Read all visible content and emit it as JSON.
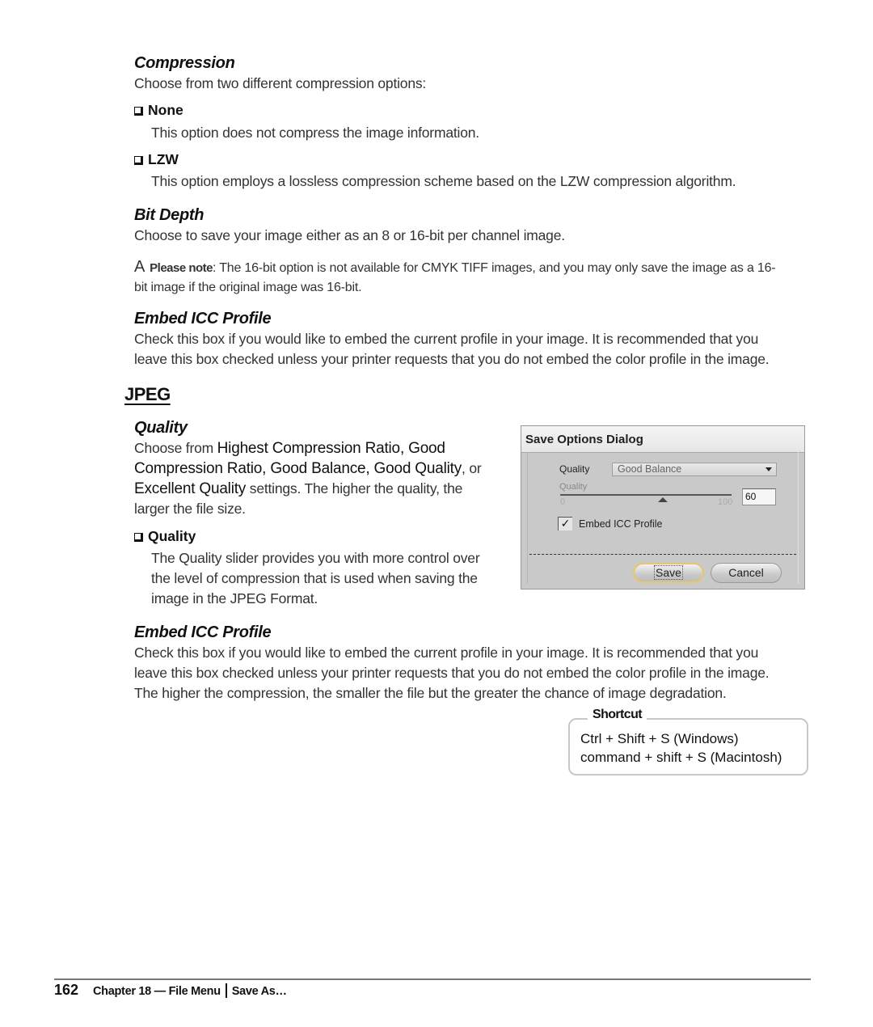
{
  "compression": {
    "heading": "Compression",
    "intro": "Choose from two different compression options:",
    "options": [
      {
        "label": "None",
        "description": "This option does not compress the image information."
      },
      {
        "label": "LZW",
        "description": "This option employs a lossless compression scheme based on the LZW compression algorithm."
      }
    ]
  },
  "bit_depth": {
    "heading": "Bit Depth",
    "text": "Choose to save your image either as an 8 or 16-bit per channel image.",
    "note_icon": "A",
    "note_label": "Please note",
    "note_text_1": ": The 16-bit option is not available for CMYK TIFF images, and you may only save the image as a 16-",
    "note_text_2": "bit image if the original image was 16-bit."
  },
  "embed_icc_tiff": {
    "heading": "Embed ICC Profile",
    "line1": "Check this box if you would like to embed the current profile in your image. It is recommended that you",
    "line2": "leave this box checked unless your printer requests that you do not embed the color profile in the image."
  },
  "jpeg": {
    "title": "JPEG",
    "quality": {
      "heading": "Quality",
      "choose_from": "Choose from ",
      "opt1": "Highest Compression Ratio",
      "sep1": ", ",
      "opt2a": "Good",
      "opt2b": "Compression Ratio",
      "sep2": ", ",
      "opt3": "Good Balance",
      "sep3": ", ",
      "opt4": "Good Quality",
      "or": ", or",
      "opt5": "Excellent Quality",
      "settings_text": " settings. The higher the quality, the",
      "last_line": "larger the file size.",
      "sub_option": {
        "label": "Quality",
        "line1": "The Quality slider provides you with more control over",
        "line2": "the level of compression that is used when saving the",
        "line3": "image in the JPEG Format."
      }
    },
    "embed_icc": {
      "heading": "Embed ICC Profile",
      "line1": "Check this box if you would like to embed the current profile in your image. It is recommended that you",
      "line2": "leave this box checked unless your printer requests that you do not embed the color profile in the image.",
      "line3": "The higher the compression, the smaller the file but the greater the chance of image degradation."
    }
  },
  "dialog": {
    "title": "Save Options Dialog",
    "quality_label": "Quality",
    "quality_select_value": "Good Balance",
    "slider_label": "Quality",
    "slider_min": "0",
    "slider_max": "100",
    "slider_value_fraction": 0.6,
    "quality_input_value": "60",
    "embed_checkbox_checked": true,
    "embed_checkbox_mark": "✓",
    "embed_checkbox_label": "Embed ICC Profile",
    "save_label": "Save",
    "cancel_label": "Cancel"
  },
  "shortcut": {
    "label": "Shortcut",
    "windows": "Ctrl + Shift + S (Windows)",
    "mac": "command + shift + S (Macintosh)"
  },
  "footer": {
    "page_number": "162",
    "chapter": "Chapter 18 — File Menu",
    "section": "Save As…"
  }
}
